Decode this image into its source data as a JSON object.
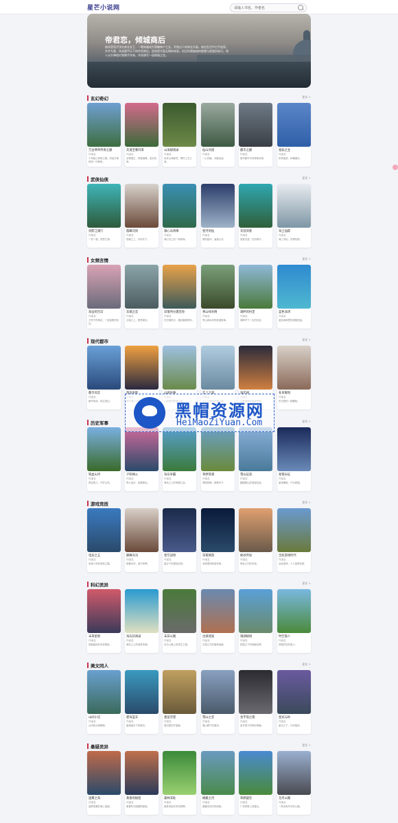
{
  "site": {
    "logo": "星芒小说网",
    "search_placeholder": "请输入书名、作者名"
  },
  "hero": {
    "title": "帝君恋，倾城商后",
    "description": "她本是现代顶尖商业女王，一朝穿越成为落魄商户之女。凭借过人的商业头脑，她在乱世中白手起家，步步为营，终成富甲天下的传奇商后。而他是冷面无情的帝君，初见时便被她的聪慧与倔强所吸引。两人从针锋相对到携手并肩，共同谱写一段倾城之恋。"
  },
  "sections": [
    {
      "title": "玄幻奇幻",
      "more": "更多 >",
      "books": [
        {
          "title": "万古神帝传奇之巅",
          "author": "作者名",
          "desc": "少年踏上修炼之路，历经万难终成一代神帝。"
        },
        {
          "title": "天道至尊归来",
          "author": "作者名",
          "desc": "至尊重生，再登巅峰，逆天改命。"
        },
        {
          "title": "山海秘境录",
          "author": "作者名",
          "desc": "探寻山海秘境，揭开上古之谜。"
        },
        {
          "title": "仙山问道",
          "author": "作者名",
          "desc": "一心向道，问鼎仙途。"
        },
        {
          "title": "都市之巅",
          "author": "作者名",
          "desc": "繁华都市中的修炼传奇。"
        },
        {
          "title": "星辰之主",
          "author": "作者名",
          "desc": "执掌星辰，纵横诸天。"
        }
      ]
    },
    {
      "title": "武侠仙侠",
      "more": "更多 >",
      "books": [
        {
          "title": "剑影江湖行",
          "author": "作者名",
          "desc": "一剑一酒，快意江湖。"
        },
        {
          "title": "孤峰问剑",
          "author": "作者名",
          "desc": "孤峰之上，问剑天下。"
        },
        {
          "title": "湖心岛奇缘",
          "author": "作者名",
          "desc": "湖心岛上的一段奇缘。"
        },
        {
          "title": "星河剑仙",
          "author": "作者名",
          "desc": "御剑星河，逍遥九天。"
        },
        {
          "title": "天涯剑客",
          "author": "作者名",
          "desc": "浪迹天涯，仗剑而行。"
        },
        {
          "title": "海上仙踪",
          "author": "作者名",
          "desc": "海上寻仙，觅得仙踪。"
        }
      ]
    },
    {
      "title": "女频言情",
      "more": "更多 >",
      "books": [
        {
          "title": "海边的告白",
          "author": "作者名",
          "desc": "夕阳下的海边，一段温柔的告白。"
        },
        {
          "title": "云端之恋",
          "author": "作者名",
          "desc": "云端之上，爱意绵长。"
        },
        {
          "title": "日落时分遇见你",
          "author": "作者名",
          "desc": "在日落时分，遇见最美的你。"
        },
        {
          "title": "青山绿水情",
          "author": "作者名",
          "desc": "青山绿水间的浪漫故事。"
        },
        {
          "title": "湖畔的约定",
          "author": "作者名",
          "desc": "湖畔许下一生的约定。"
        },
        {
          "title": "蓝色海湾",
          "author": "作者名",
          "desc": "蓝色海湾里的甜蜜恋曲。"
        }
      ]
    },
    {
      "title": "现代都市",
      "more": "更多 >",
      "books": [
        {
          "title": "都市风云",
          "author": "作者名",
          "desc": "都市商战，风云变幻。"
        },
        {
          "title": "落日余晖",
          "author": "作者名",
          "desc": "城市落日下的奋斗人生。"
        },
        {
          "title": "山城往事",
          "author": "作者名",
          "desc": "山城里的青春往事。"
        },
        {
          "title": "云上之城",
          "author": "作者名",
          "desc": "云上之城的逆袭之路。"
        },
        {
          "title": "海岸线",
          "author": "作者名",
          "desc": "沿着海岸线追逐梦想。"
        },
        {
          "title": "冬日暖阳",
          "author": "作者名",
          "desc": "冬日里的一缕暖阳。"
        }
      ]
    },
    {
      "title": "历史军事",
      "more": "更多 >",
      "books": [
        {
          "title": "铁血山河",
          "author": "作者名",
          "desc": "铁血男儿，守护山河。"
        },
        {
          "title": "夕阳烽火",
          "author": "作者名",
          "desc": "烽火连天，英雄辈出。"
        },
        {
          "title": "海岛争霸",
          "author": "作者名",
          "desc": "海岛之上的争霸之战。"
        },
        {
          "title": "草原铁骑",
          "author": "作者名",
          "desc": "草原铁骑，驰骋天下。"
        },
        {
          "title": "雪山征途",
          "author": "作者名",
          "desc": "翻越雪山的漫漫征途。"
        },
        {
          "title": "星夜长征",
          "author": "作者名",
          "desc": "星夜兼程，只为家国。"
        }
      ]
    },
    {
      "title": "游戏竞技",
      "more": "更多 >",
      "books": [
        {
          "title": "电竞之王",
          "author": "作者名",
          "desc": "电竞少年的冠军之路。"
        },
        {
          "title": "巅峰对决",
          "author": "作者名",
          "desc": "巅峰对决，谁与争锋。"
        },
        {
          "title": "星空战场",
          "author": "作者名",
          "desc": "星空下的虚拟战场。"
        },
        {
          "title": "深夜网游",
          "author": "作者名",
          "desc": "深夜里的网游传奇。"
        },
        {
          "title": "峡谷传说",
          "author": "作者名",
          "desc": "峡谷之中的传说。"
        },
        {
          "title": "全民游戏时代",
          "author": "作者名",
          "desc": "全民游戏，人人皆是玩家。"
        }
      ]
    },
    {
      "title": "科幻灵异",
      "more": "更多 >",
      "books": [
        {
          "title": "未来星际",
          "author": "作者名",
          "desc": "穿越星际的未来冒险。"
        },
        {
          "title": "海岛异闻录",
          "author": "作者名",
          "desc": "海岛之上的诡异传闻。"
        },
        {
          "title": "末日公路",
          "author": "作者名",
          "desc": "末日公路上的求生之旅。"
        },
        {
          "title": "古城谜案",
          "author": "作者名",
          "desc": "古城之中的离奇谜案。"
        },
        {
          "title": "镜湖秘境",
          "author": "作者名",
          "desc": "镜湖之下的神秘世界。"
        },
        {
          "title": "时空旅人",
          "author": "作者名",
          "desc": "穿梭时空的旅人。"
        }
      ]
    },
    {
      "title": "美文同人",
      "more": "更多 >",
      "books": [
        {
          "title": "山间小记",
          "author": "作者名",
          "desc": "山间的点滴随笔。"
        },
        {
          "title": "碧海蓝天",
          "author": "作者名",
          "desc": "碧海蓝天下的美文。"
        },
        {
          "title": "麦田守望",
          "author": "作者名",
          "desc": "麦田里的守望者。"
        },
        {
          "title": "雪山之恋",
          "author": "作者名",
          "desc": "雪山脚下的爱恋。"
        },
        {
          "title": "金字塔之夜",
          "author": "作者名",
          "desc": "金字塔下的奇妙夜晚。"
        },
        {
          "title": "星光与你",
          "author": "作者名",
          "desc": "星光之下，与你相伴。"
        }
      ]
    },
    {
      "title": "悬疑灵异",
      "more": "更多 >",
      "books": [
        {
          "title": "迷雾之海",
          "author": "作者名",
          "desc": "迷雾笼罩的海上谜团。"
        },
        {
          "title": "黄昏的秘密",
          "author": "作者名",
          "desc": "黄昏时分隐藏的秘密。"
        },
        {
          "title": "森林深处",
          "author": "作者名",
          "desc": "森林深处的未知恐惧。"
        },
        {
          "title": "蜿蜒之河",
          "author": "作者名",
          "desc": "蜿蜒河流中的线索。"
        },
        {
          "title": "草原疑云",
          "author": "作者名",
          "desc": "广袤草原上的疑云。"
        },
        {
          "title": "无尽公路",
          "author": "作者名",
          "desc": "一条没有尽头的公路。"
        }
      ]
    }
  ],
  "watermark": {
    "cn": "黑帽资源网",
    "en": "HeiMaoZiYuan.Com"
  }
}
